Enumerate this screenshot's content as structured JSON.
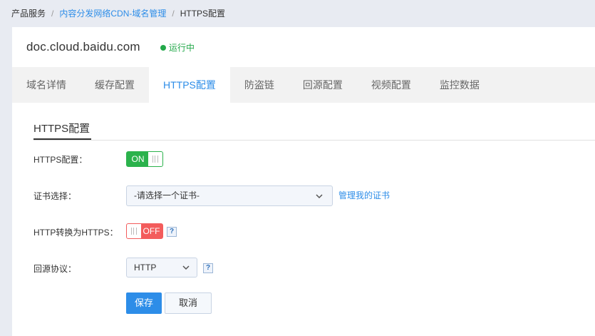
{
  "breadcrumb": {
    "items": [
      "产品服务",
      "内容分发网络CDN-域名管理",
      "HTTPS配置"
    ],
    "separator": "/"
  },
  "header": {
    "domain": "doc.cloud.baidu.com",
    "status": "运行中",
    "status_color": "#23a84a"
  },
  "tabs": [
    {
      "label": "域名详情",
      "active": false
    },
    {
      "label": "缓存配置",
      "active": false
    },
    {
      "label": "HTTPS配置",
      "active": true
    },
    {
      "label": "防盗链",
      "active": false
    },
    {
      "label": "回源配置",
      "active": false
    },
    {
      "label": "视频配置",
      "active": false
    },
    {
      "label": "监控数据",
      "active": false
    }
  ],
  "section": {
    "title": "HTTPS配置"
  },
  "form": {
    "https_label": "HTTPS配置：",
    "https_toggle": {
      "text": "ON",
      "state": "on"
    },
    "cert_label": "证书选择：",
    "cert_select": {
      "value": "-请选择一个证书-"
    },
    "manage_cert_link": "管理我的证书",
    "redirect_label": "HTTP转换为HTTPS：",
    "redirect_toggle": {
      "text": "OFF",
      "state": "off"
    },
    "origin_label": "回源协议：",
    "origin_select": {
      "value": "HTTP"
    },
    "help_glyph": "?"
  },
  "actions": {
    "save": "保存",
    "cancel": "取消"
  },
  "colors": {
    "accent": "#2d8de8",
    "on": "#2bb24c",
    "off": "#f35c5c"
  }
}
